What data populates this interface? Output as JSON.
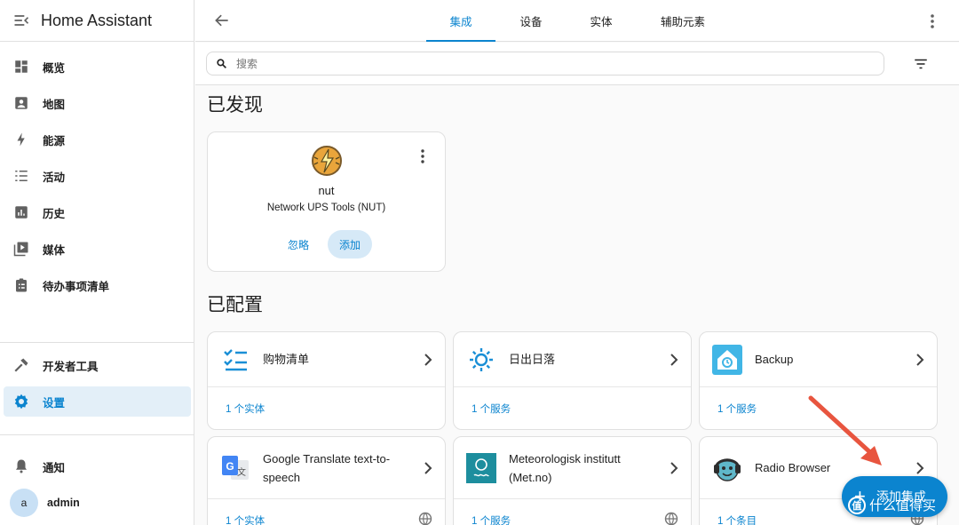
{
  "app": {
    "title": "Home Assistant"
  },
  "sidebar": {
    "items": [
      {
        "label": "概览",
        "icon": "dashboard-icon"
      },
      {
        "label": "地图",
        "icon": "map-icon"
      },
      {
        "label": "能源",
        "icon": "lightning-icon"
      },
      {
        "label": "活动",
        "icon": "list-icon"
      },
      {
        "label": "历史",
        "icon": "chart-icon"
      },
      {
        "label": "媒体",
        "icon": "play-box-icon"
      },
      {
        "label": "待办事项清单",
        "icon": "clipboard-icon"
      }
    ],
    "dev_tools": "开发者工具",
    "settings": "设置",
    "notifications": "通知",
    "user": {
      "initial": "a",
      "name": "admin"
    }
  },
  "topbar": {
    "tabs": [
      "集成",
      "设备",
      "实体",
      "辅助元素"
    ],
    "active_tab": "集成"
  },
  "search": {
    "placeholder": "搜索"
  },
  "discovered": {
    "title": "已发现",
    "card": {
      "name": "nut",
      "subtitle": "Network UPS Tools (NUT)",
      "ignore_label": "忽略",
      "add_label": "添加"
    }
  },
  "configured": {
    "title": "已配置",
    "cards": [
      {
        "name": "购物清单",
        "footer": "1 个实体",
        "logo": "shopping-list-icon"
      },
      {
        "name": "日出日落",
        "footer": "1 个服务",
        "logo": "sun-icon"
      },
      {
        "name": "Backup",
        "footer": "1 个服务",
        "logo": "backup-icon"
      },
      {
        "name": "Google Translate text-to-speech",
        "footer": "1 个实体",
        "logo": "google-translate-icon"
      },
      {
        "name": "Meteorologisk institutt (Met.no)",
        "footer": "1 个服务",
        "logo": "met-no-icon"
      },
      {
        "name": "Radio Browser",
        "footer": "1 个条目",
        "logo": "radio-browser-icon"
      }
    ]
  },
  "fab": {
    "label": "添加集成"
  },
  "watermark": {
    "text": "什么值得买",
    "badge": "值"
  },
  "colors": {
    "accent": "#0b84cf",
    "annotation": "#e8553f"
  }
}
